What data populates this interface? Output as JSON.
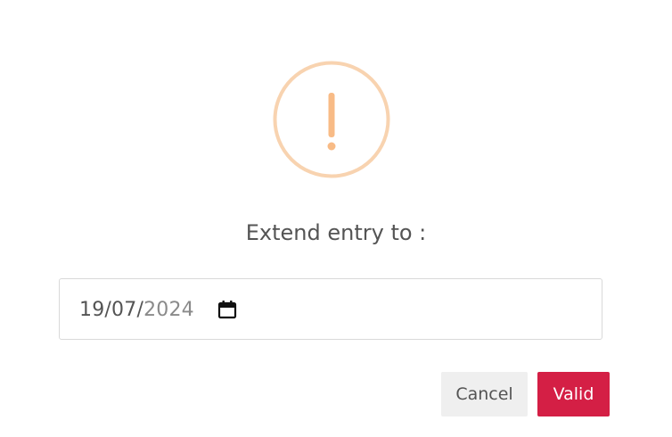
{
  "dialog": {
    "icon": "warning-exclamation-icon",
    "icon_color": "#f8bb86",
    "icon_glyph": "!",
    "title": "Extend entry to :",
    "date_input": {
      "day": "19",
      "month": "07",
      "year": "2024",
      "sep1": "/",
      "sep2": "/",
      "value": "19/07/2024",
      "icon": "calendar-icon"
    },
    "buttons": {
      "cancel_label": "Cancel",
      "valid_label": "Valid",
      "valid_color": "#d41f45",
      "cancel_color": "#efefef"
    }
  }
}
